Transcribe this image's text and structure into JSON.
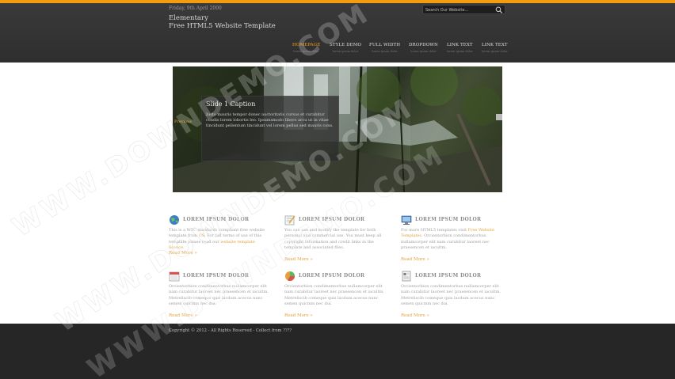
{
  "header": {
    "date": "Friday, 9th April 2000",
    "search_placeholder": "Search Our Website...",
    "title_line1": "Elementary",
    "title_line2": "Free HTML5 Website Template"
  },
  "nav": [
    {
      "label": "HOMEPAGE",
      "sub": "lorem ipsum dolor"
    },
    {
      "label": "STYLE DEMO",
      "sub": "lorem ipsum dolor"
    },
    {
      "label": "FULL WIDTH",
      "sub": "lorem ipsum dolor"
    },
    {
      "label": "DROPDOWN",
      "sub": "lorem ipsum dolor"
    },
    {
      "label": "LINK TEXT",
      "sub": "lorem ipsum dolor"
    },
    {
      "label": "LINK TEXT",
      "sub": "lorem ipsum dolor"
    }
  ],
  "slider": {
    "caption_title": "Slide 1 Caption",
    "caption_text": "Justo mauris tempor donec auctoritatis cursus et curabitur condis lorem lobortis leo. Ipsumsmodo libero arcu ut in vitae tincidunt pellentum tincidunt vel lorem pellus sed mauris cons.",
    "prev_label": "Previous"
  },
  "features": [
    {
      "title": "LOREM IPSUM DOLOR",
      "body_a": "This is a W3C standards compliant free website template from ",
      "link1": "OS",
      "body_b": ". For full terms of use of this template please read our ",
      "link2": "website template licence",
      "body_c": ".",
      "more": "Read More »"
    },
    {
      "title": "LOREM IPSUM DOLOR",
      "body_a": "You can use and modify the template for both personal and commercial use. You must keep all copyright information and credit links in the template and associated files.",
      "more": "Read More »"
    },
    {
      "title": "LOREM IPSUM DOLOR",
      "body_a": "For more HTML5 templates visit ",
      "link1": "Free Website Templates",
      "body_b": ". Orcientorbion condimentorbus nullamcorper elit nam curabitur laoreet nec praesencen et iacultm.",
      "more": "Read More »"
    },
    {
      "title": "LOREM IPSUM DOLOR",
      "body_a": "Orcientorbion condimentorbus nullamcorper elit nam curabitur laoreet nec praesencen et iacultm. Metreliscib comeque quis lacdum acecus nunc semen quicmm nec dui.",
      "more": "Read More »"
    },
    {
      "title": "LOREM IPSUM DOLOR",
      "body_a": "Orcientorbion condimentorbus nullamcorper elit nam curabitur laoreet nec praesencen et iacultm. Metreliscib comeque quis lacdum acecus nunc semen quicmm nec dui.",
      "more": "Read More »"
    },
    {
      "title": "LOREM IPSUM DOLOR",
      "body_a": "Orcientorbion condimentorbus nullamcorper elit nam curabitur laoreet nec praesencen et iacultm. Metreliscib comeque quis lacdum acecus nunc semen quicmm nec dui.",
      "more": "Read More »"
    }
  ],
  "footer": {
    "copyright": "Copyright © 2012 - All Rights Reserved - Collect from ????"
  },
  "watermark_text": "WWW.DOWNDEMO.COM",
  "colors": {
    "accent": "#f39c12",
    "link": "#e6a03b",
    "header_bg": "#333333",
    "footer_bg": "#262626"
  },
  "icons": [
    "globe-icon",
    "edit-icon",
    "monitor-icon",
    "calendar-icon",
    "pie-chart-icon",
    "document-icon",
    "search-icon"
  ]
}
